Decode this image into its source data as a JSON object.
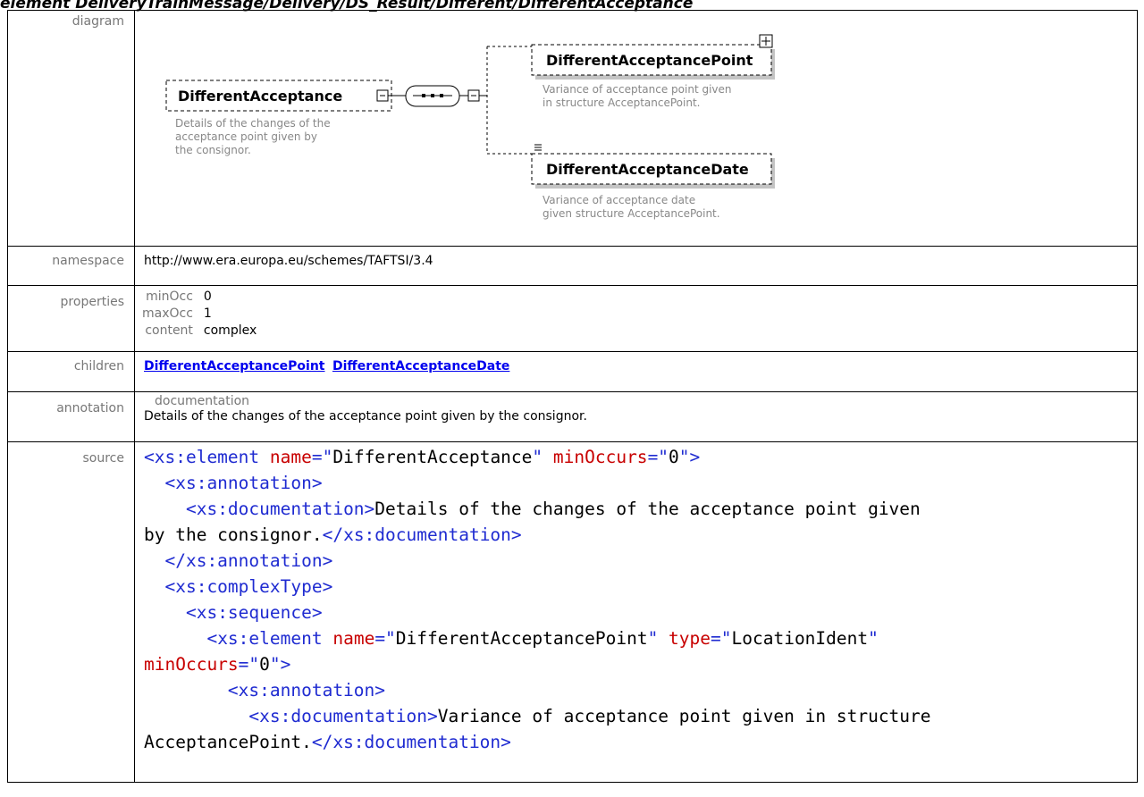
{
  "heading": "element DeliveryTrainMessage/Delivery/DS_Result/Different/DifferentAcceptance",
  "labels": {
    "diagram": "diagram",
    "namespace": "namespace",
    "properties": "properties",
    "children": "children",
    "annotation": "annotation",
    "source": "source"
  },
  "diagram": {
    "root": {
      "name": "DifferentAcceptance",
      "doc_lines": [
        "Details of the changes of the",
        "acceptance point given by",
        "the consignor."
      ]
    },
    "children": [
      {
        "name": "DifferentAcceptancePoint",
        "doc_lines": [
          "Variance of acceptance point given",
          "in structure AcceptancePoint."
        ]
      },
      {
        "name": "DifferentAcceptanceDate",
        "doc_lines": [
          "Variance of acceptance date",
          "given structure AcceptancePoint."
        ]
      }
    ]
  },
  "namespace": "http://www.era.europa.eu/schemes/TAFTSI/3.4",
  "properties": [
    {
      "key": "minOcc",
      "value": "0"
    },
    {
      "key": "maxOcc",
      "value": "1"
    },
    {
      "key": "content",
      "value": "complex"
    }
  ],
  "children_links": [
    "DifferentAcceptancePoint",
    "DifferentAcceptanceDate"
  ],
  "annotation": {
    "key": "documentation",
    "text": "Details of the changes of the acceptance point given by the consignor."
  },
  "source_lines": [
    [
      {
        "c": "tg",
        "t": "<xs:element "
      },
      {
        "c": "at",
        "t": "name"
      },
      {
        "c": "tg",
        "t": "=\""
      },
      {
        "c": "av",
        "t": "DifferentAcceptance"
      },
      {
        "c": "tg",
        "t": "\" "
      },
      {
        "c": "at",
        "t": "minOccurs"
      },
      {
        "c": "tg",
        "t": "=\""
      },
      {
        "c": "av",
        "t": "0"
      },
      {
        "c": "tg",
        "t": "\">"
      }
    ],
    [
      {
        "c": "av",
        "t": "  "
      },
      {
        "c": "tg",
        "t": "<xs:annotation>"
      }
    ],
    [
      {
        "c": "av",
        "t": "    "
      },
      {
        "c": "tg",
        "t": "<xs:documentation>"
      },
      {
        "c": "av",
        "t": "Details of the changes of the acceptance point given"
      }
    ],
    [
      {
        "c": "av",
        "t": "by the consignor."
      },
      {
        "c": "tg",
        "t": "</xs:documentation>"
      }
    ],
    [
      {
        "c": "av",
        "t": "  "
      },
      {
        "c": "tg",
        "t": "</xs:annotation>"
      }
    ],
    [
      {
        "c": "av",
        "t": "  "
      },
      {
        "c": "tg",
        "t": "<xs:complexType>"
      }
    ],
    [
      {
        "c": "av",
        "t": "    "
      },
      {
        "c": "tg",
        "t": "<xs:sequence>"
      }
    ],
    [
      {
        "c": "av",
        "t": "      "
      },
      {
        "c": "tg",
        "t": "<xs:element "
      },
      {
        "c": "at",
        "t": "name"
      },
      {
        "c": "tg",
        "t": "=\""
      },
      {
        "c": "av",
        "t": "DifferentAcceptancePoint"
      },
      {
        "c": "tg",
        "t": "\" "
      },
      {
        "c": "at",
        "t": "type"
      },
      {
        "c": "tg",
        "t": "=\""
      },
      {
        "c": "av",
        "t": "LocationIdent"
      },
      {
        "c": "tg",
        "t": "\""
      }
    ],
    [
      {
        "c": "at",
        "t": "minOccurs"
      },
      {
        "c": "tg",
        "t": "=\""
      },
      {
        "c": "av",
        "t": "0"
      },
      {
        "c": "tg",
        "t": "\">"
      }
    ],
    [
      {
        "c": "av",
        "t": "        "
      },
      {
        "c": "tg",
        "t": "<xs:annotation>"
      }
    ],
    [
      {
        "c": "av",
        "t": "          "
      },
      {
        "c": "tg",
        "t": "<xs:documentation>"
      },
      {
        "c": "av",
        "t": "Variance of acceptance point given in structure"
      }
    ],
    [
      {
        "c": "av",
        "t": "AcceptancePoint."
      },
      {
        "c": "tg",
        "t": "</xs:documentation>"
      }
    ]
  ]
}
